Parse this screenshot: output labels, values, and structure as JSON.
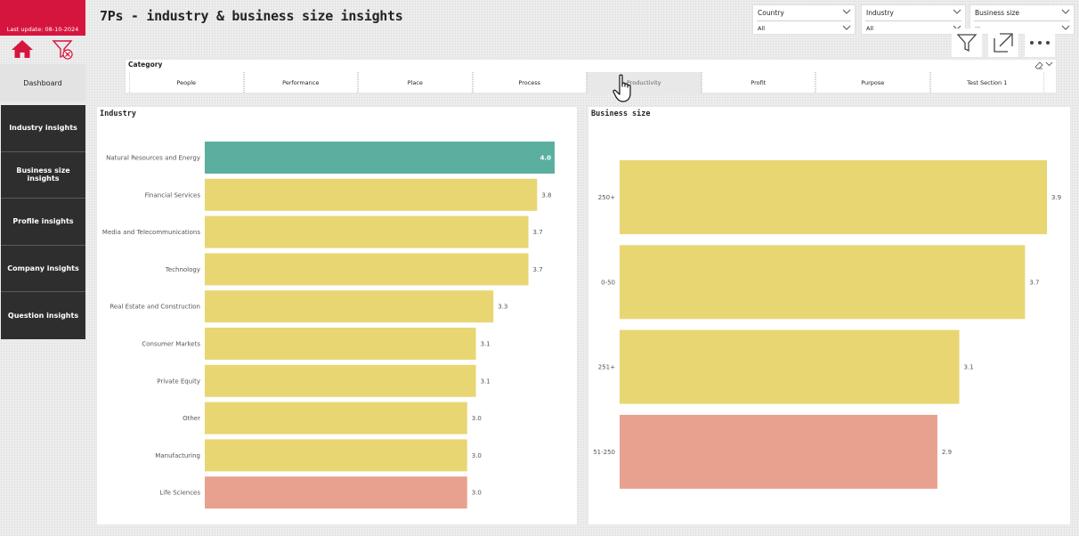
{
  "brand": {
    "last_update": "Last update: 08-10-2024",
    "color": "#d6153f"
  },
  "nav": {
    "home_icon": "home-icon",
    "clear_filter_icon": "clear-filter-icon",
    "dashboard_label": "Dashboard",
    "items": [
      {
        "label": "Industry insights"
      },
      {
        "label": "Business size insights"
      },
      {
        "label": "Profile insights"
      },
      {
        "label": "Company insights"
      },
      {
        "label": "Question insights"
      }
    ]
  },
  "header": {
    "title": "7Ps - industry & business size insights"
  },
  "filters": {
    "country": {
      "label": "Country",
      "value": "All"
    },
    "industry": {
      "label": "Industry",
      "value": "All"
    },
    "business_size": {
      "label": "Business size",
      "value": "..."
    }
  },
  "toolbar": {
    "filter_icon": "filter-icon",
    "focus_icon": "focus-mode-icon",
    "more_icon": "more-options-icon"
  },
  "category": {
    "label": "Category",
    "selected": "Productivity",
    "options": [
      "People",
      "Performance",
      "Place",
      "Process",
      "Productivity",
      "Profit",
      "Purpose",
      "Test Section 1"
    ]
  },
  "colors": {
    "highlight": "#5baf9f",
    "default": "#e8d672",
    "low": "#e8a18f"
  },
  "chart_data": [
    {
      "type": "bar",
      "orientation": "horizontal",
      "title": "Industry",
      "categories": [
        "Natural Resources and Energy",
        "Financial Services",
        "Media and Telecommunications",
        "Technology",
        "Real Estate and Construction",
        "Consumer Markets",
        "Private Equity",
        "Other",
        "Manufacturing",
        "Life Sciences"
      ],
      "values": [
        4.0,
        3.8,
        3.7,
        3.7,
        3.3,
        3.1,
        3.1,
        3.0,
        3.0,
        3.0
      ],
      "value_labels": [
        "4.0",
        "3.8",
        "3.7",
        "3.7",
        "3.3",
        "3.1",
        "3.1",
        "3.0",
        "3.0",
        "3.0"
      ],
      "bar_colors": [
        "highlight",
        "default",
        "default",
        "default",
        "default",
        "default",
        "default",
        "default",
        "default",
        "low"
      ],
      "xlim": [
        0,
        4.0
      ],
      "grid": false
    },
    {
      "type": "bar",
      "orientation": "horizontal",
      "title": "Business size",
      "categories": [
        "250+",
        "0-50",
        "251+",
        "51-250"
      ],
      "values": [
        3.9,
        3.7,
        3.1,
        2.9
      ],
      "value_labels": [
        "3.9",
        "3.7",
        "3.1",
        "2.9"
      ],
      "bar_colors": [
        "default",
        "default",
        "default",
        "low"
      ],
      "xlim": [
        0,
        3.9
      ],
      "grid": false
    }
  ]
}
